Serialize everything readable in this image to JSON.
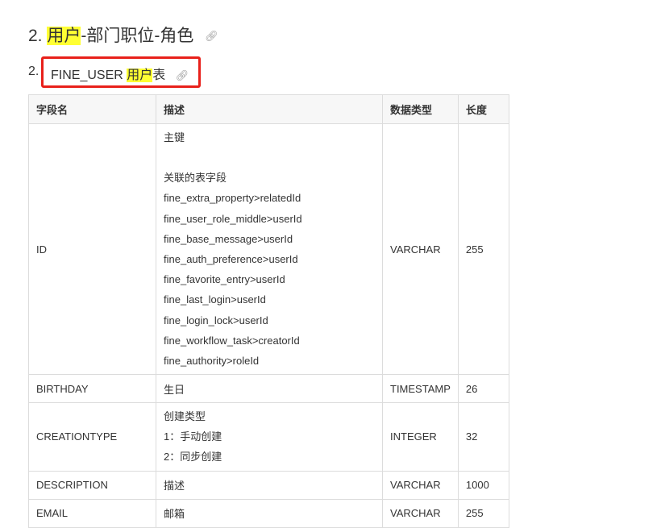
{
  "section": {
    "number": "2.",
    "highlight": "用户",
    "rest": "-部门职位-角色",
    "link_icon": "link-icon"
  },
  "subsection": {
    "number": "2.",
    "prefix": "FINE_USER ",
    "highlight": "用户",
    "suffix": "表",
    "link_icon": "link-icon"
  },
  "colors": {
    "highlight": "#ffff33",
    "annotation_box": "#e8201a"
  },
  "table": {
    "headers": [
      "字段名",
      "描述",
      "数据类型",
      "长度"
    ],
    "rows": [
      {
        "name": "ID",
        "desc": [
          "主键",
          "",
          "关联的表字段",
          "fine_extra_property>relatedId",
          "fine_user_role_middle>userId",
          "fine_base_message>userId",
          "fine_auth_preference>userId",
          "fine_favorite_entry>userId",
          "fine_last_login>userId",
          "fine_login_lock>userId",
          "fine_workflow_task>creatorId",
          "fine_authority>roleId"
        ],
        "type": "VARCHAR",
        "length": "255"
      },
      {
        "name": "BIRTHDAY",
        "desc": [
          "生日"
        ],
        "type": "TIMESTAMP",
        "length": "26"
      },
      {
        "name": "CREATIONTYPE",
        "desc": [
          "创建类型",
          "1：手动创建",
          "2：同步创建"
        ],
        "type": "INTEGER",
        "length": "32"
      },
      {
        "name": "DESCRIPTION",
        "desc": [
          "描述"
        ],
        "type": "VARCHAR",
        "length": "1000"
      },
      {
        "name": "EMAIL",
        "desc": [
          "邮箱"
        ],
        "type": "VARCHAR",
        "length": "255"
      }
    ]
  }
}
